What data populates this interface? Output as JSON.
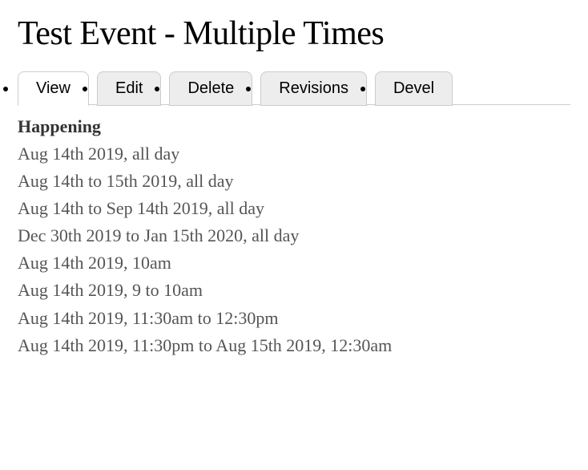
{
  "page": {
    "title": "Test Event - Multiple Times"
  },
  "tabs": [
    {
      "label": "View",
      "active": true
    },
    {
      "label": "Edit",
      "active": false
    },
    {
      "label": "Delete",
      "active": false
    },
    {
      "label": "Revisions",
      "active": false
    },
    {
      "label": "Devel",
      "active": false
    }
  ],
  "field": {
    "label": "Happening",
    "dates": [
      "Aug 14th 2019, all day",
      "Aug 14th to 15th 2019, all day",
      "Aug 14th to Sep 14th 2019, all day",
      "Dec 30th 2019 to Jan 15th 2020, all day",
      "Aug 14th 2019, 10am",
      "Aug 14th 2019, 9 to 10am",
      "Aug 14th 2019, 11:30am to 12:30pm",
      "Aug 14th 2019, 11:30pm to Aug 15th 2019, 12:30am"
    ]
  }
}
